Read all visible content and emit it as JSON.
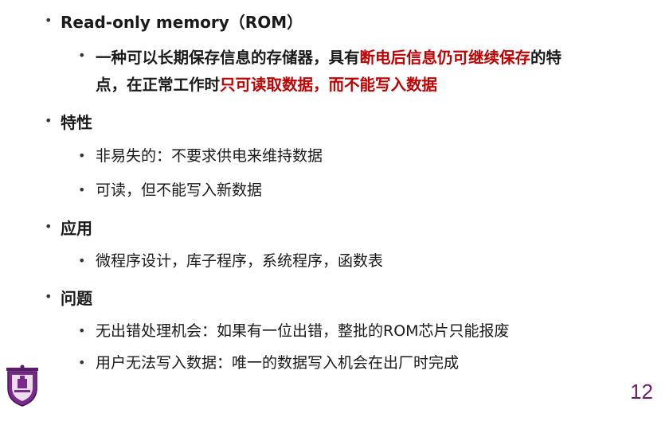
{
  "slide": {
    "items": [
      {
        "text": "Read-only memory（ROM）"
      },
      {
        "sub": [
          {
            "parts": [
              "一种可以长期保存信息的存储器，具有",
              "断电后信息仍可继续保存",
              "的特"
            ],
            "line2_parts": [
              "点，在正常工作时",
              "只可读取数据，而不能写入数据"
            ]
          }
        ]
      },
      {
        "text": "特性"
      },
      {
        "sub": [
          {
            "text": "非易失的：不要求供电来维持数据"
          },
          {
            "text": "可读，但不能写入新数据"
          }
        ]
      },
      {
        "text": "应用"
      },
      {
        "sub": [
          {
            "text": "微程序设计，库子程序，系统程序，函数表"
          }
        ]
      },
      {
        "text": "问题"
      },
      {
        "sub": [
          {
            "text": "无出错处理机会：如果有一位出错，整批的ROM芯片只能报废"
          },
          {
            "text": "用户无法写入数据：唯一的数据写入机会在出厂时完成"
          }
        ]
      }
    ],
    "page_number": "12",
    "logo_icon": "university-crest-icon",
    "accent_color": "#c00000",
    "page_number_color": "#6b1f6b"
  }
}
